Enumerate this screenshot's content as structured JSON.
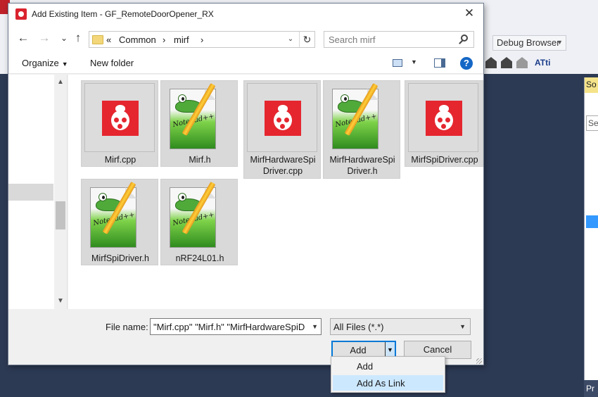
{
  "ide": {
    "toolbar_combo": "Debug Browser",
    "toolbar_text": "ATti",
    "panel_header": "So",
    "panel_search": "Se",
    "bottom_tab": "Pr"
  },
  "dialog": {
    "title": "Add Existing Item - GF_RemoteDoorOpener_RX",
    "close_glyph": "✕",
    "nav": {
      "back": "←",
      "forward": "→",
      "history": "⌄",
      "up": "↑",
      "breadcrumb": [
        "«",
        "Common",
        "›",
        "mirf",
        "›"
      ],
      "dropdown": "⌄",
      "refresh": "↻"
    },
    "search": {
      "placeholder": "Search mirf"
    },
    "commands": {
      "organize": "Organize",
      "new_folder": "New folder",
      "help": "?"
    },
    "files": [
      {
        "name": "Mirf.cpp",
        "icon": "atmel-studio-icon"
      },
      {
        "name": "Mirf.h",
        "icon": "notepad-plus-plus-icon"
      },
      {
        "name": "MirfHardwareSpiDriver.cpp",
        "line1": "MirfHardwareSpi",
        "line2": "Driver.cpp",
        "icon": "atmel-studio-icon"
      },
      {
        "name": "MirfHardwareSpiDriver.h",
        "line1": "MirfHardwareSpi",
        "line2": "Driver.h",
        "icon": "notepad-plus-plus-icon"
      },
      {
        "name": "MirfSpiDriver.cpp",
        "icon": "atmel-studio-icon"
      },
      {
        "name": "MirfSpiDriver.h",
        "icon": "notepad-plus-plus-icon"
      },
      {
        "name": "nRF24L01.h",
        "icon": "notepad-plus-plus-icon"
      }
    ],
    "notepad_brand": "Notepad++",
    "file_name_label": "File name:",
    "file_name_value": "\"Mirf.cpp\" \"Mirf.h\" \"MirfHardwareSpiD",
    "file_type_value": "All Files (*.*)",
    "add_label": "Add",
    "cancel_label": "Cancel"
  },
  "add_menu": {
    "items": [
      "Add",
      "Add As Link"
    ],
    "highlighted": "Add As Link"
  },
  "colors": {
    "accent": "#0078d7",
    "atmel_red": "#e5262f",
    "ide_background": "#2d3a54",
    "menu_highlight": "#cce8ff"
  }
}
